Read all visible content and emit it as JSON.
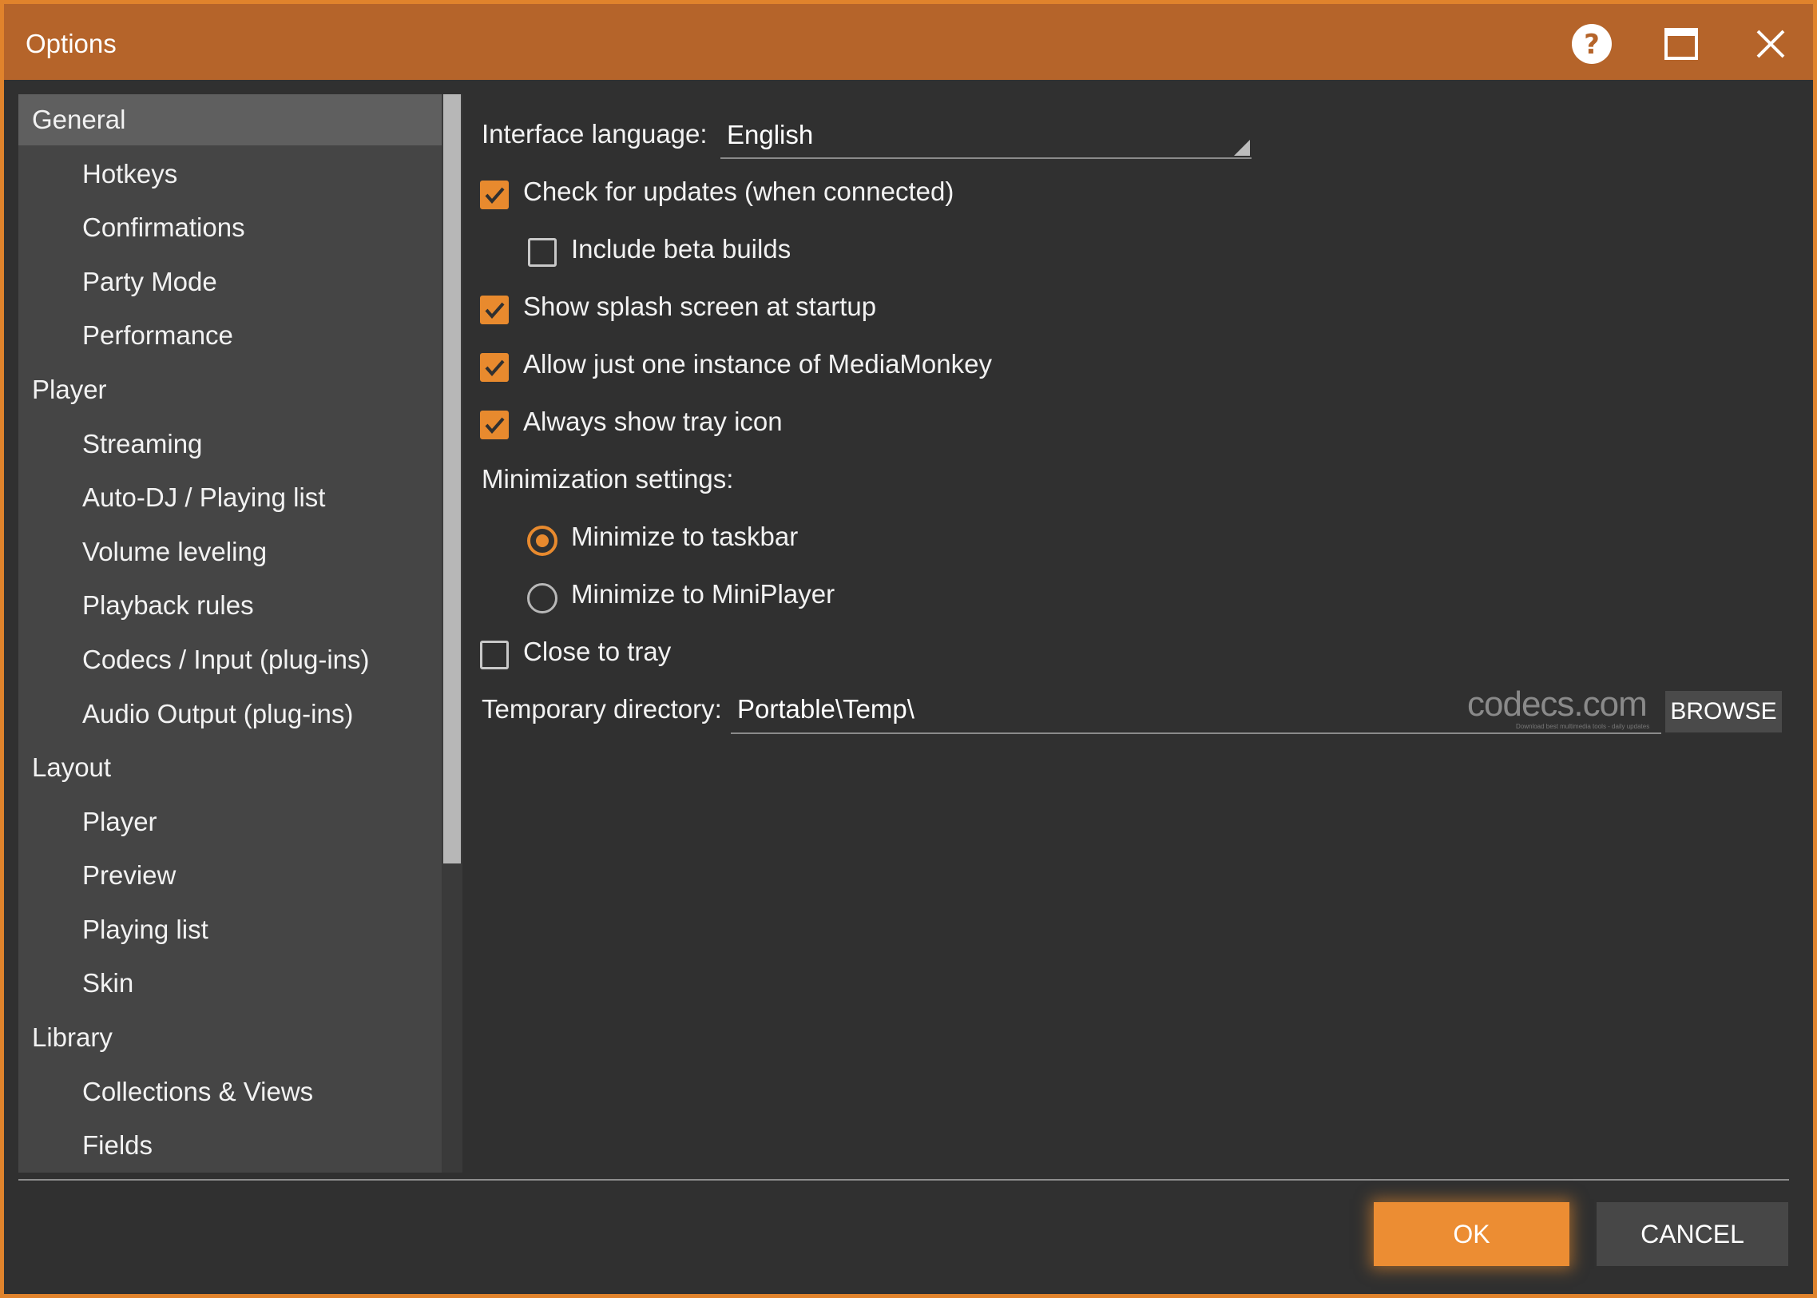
{
  "window": {
    "title": "Options",
    "accent_color": "#e88a2e",
    "titlebar_color": "#b5642a",
    "background_color": "#303030"
  },
  "titlebar_buttons": {
    "help_icon": "question-circle-icon",
    "maximize_icon": "maximize-icon",
    "close_icon": "close-icon"
  },
  "sidebar": {
    "items": [
      {
        "label": "General",
        "level": 0,
        "selected": true
      },
      {
        "label": "Hotkeys",
        "level": 1
      },
      {
        "label": "Confirmations",
        "level": 1
      },
      {
        "label": "Party Mode",
        "level": 1
      },
      {
        "label": "Performance",
        "level": 1
      },
      {
        "label": "Player",
        "level": 0
      },
      {
        "label": "Streaming",
        "level": 1
      },
      {
        "label": "Auto-DJ / Playing list",
        "level": 1
      },
      {
        "label": "Volume leveling",
        "level": 1
      },
      {
        "label": "Playback rules",
        "level": 1
      },
      {
        "label": "Codecs / Input (plug-ins)",
        "level": 1
      },
      {
        "label": "Audio Output (plug-ins)",
        "level": 1
      },
      {
        "label": "Layout",
        "level": 0
      },
      {
        "label": "Player",
        "level": 1
      },
      {
        "label": "Preview",
        "level": 1
      },
      {
        "label": "Playing list",
        "level": 1
      },
      {
        "label": "Skin",
        "level": 1
      },
      {
        "label": "Library",
        "level": 0
      },
      {
        "label": "Collections & Views",
        "level": 1
      },
      {
        "label": "Fields",
        "level": 1
      }
    ]
  },
  "general": {
    "language_label": "Interface language:",
    "language_value": "English",
    "check_updates": {
      "label": "Check for updates (when connected)",
      "checked": true
    },
    "include_beta": {
      "label": "Include beta builds",
      "checked": false
    },
    "splash_screen": {
      "label": "Show splash screen at startup",
      "checked": true
    },
    "one_instance": {
      "label": "Allow just one instance of MediaMonkey",
      "checked": true
    },
    "tray_icon": {
      "label": "Always show tray icon",
      "checked": true
    },
    "minimization_label": "Minimization settings:",
    "minimize_taskbar": {
      "label": "Minimize to taskbar",
      "selected": true
    },
    "minimize_miniplayer": {
      "label": "Minimize to MiniPlayer",
      "selected": false
    },
    "close_to_tray": {
      "label": "Close to tray",
      "checked": false
    },
    "temp_dir_label": "Temporary directory:",
    "temp_dir_value": "Portable\\Temp\\",
    "browse_label": "BROWSE"
  },
  "watermark": {
    "text": "codecs.com",
    "subtext": "Download best multimedia tools - daily updates"
  },
  "footer": {
    "ok_label": "OK",
    "cancel_label": "CANCEL"
  }
}
